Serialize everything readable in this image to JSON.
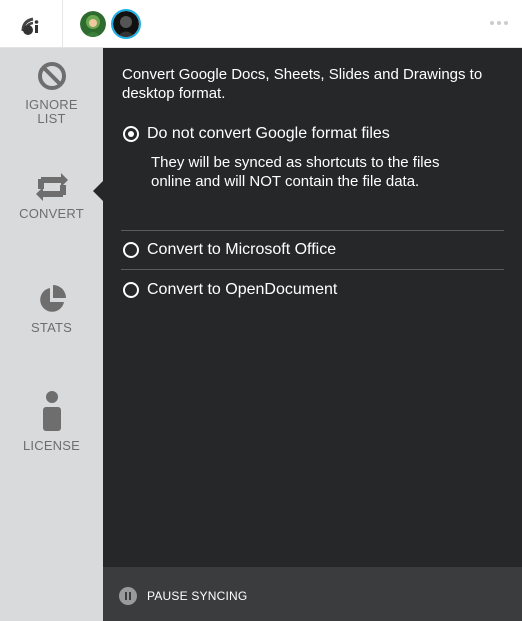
{
  "sidebar": {
    "items": [
      {
        "label_line1": "IGNORE",
        "label_line2": "LIST",
        "icon": "block-icon"
      },
      {
        "label": "CONVERT",
        "icon": "convert-icon"
      },
      {
        "label": "STATS",
        "icon": "pie-chart-icon"
      },
      {
        "label": "LICENSE",
        "icon": "person-icon"
      }
    ]
  },
  "main": {
    "intro": "Convert Google Docs, Sheets, Slides and Drawings to desktop format.",
    "options": [
      {
        "label": "Do not convert Google format files",
        "selected": true,
        "description": "They will be synced as shortcuts to the files online and will NOT contain the file data."
      },
      {
        "label": "Convert to Microsoft Office",
        "selected": false
      },
      {
        "label": "Convert to OpenDocument",
        "selected": false
      }
    ]
  },
  "footer": {
    "pause_label": "PAUSE SYNCING"
  },
  "colors": {
    "panel_bg": "#262729",
    "sidebar_bg": "#d9dadc",
    "footer_bg": "#3b3c3e",
    "avatar_ring": "#1db0e6"
  }
}
